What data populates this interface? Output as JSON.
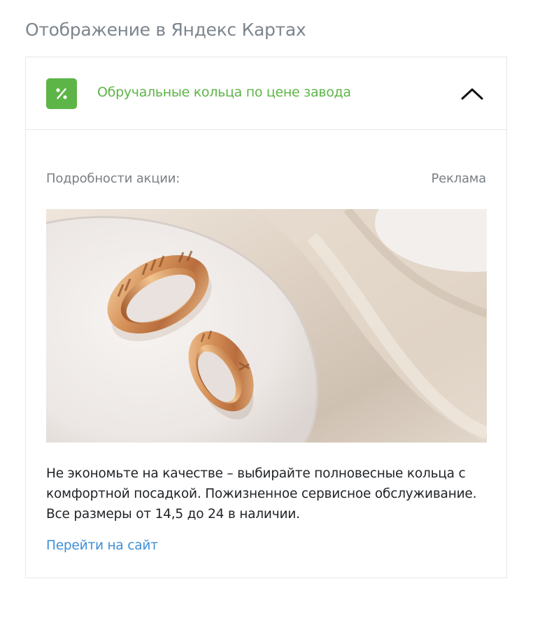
{
  "page": {
    "section_title": "Отображение в Яндекс Картах"
  },
  "promo": {
    "badge_icon": "percent-icon",
    "badge_color": "#5db548",
    "title": "Обручальные кольца по цене завода",
    "title_color": "#5db548",
    "collapse_icon": "chevron-up-icon",
    "details_label": "Подробности акции:",
    "ad_label": "Реклама",
    "image": "wedding-rings-photo",
    "description": "Не экономьте на качестве – выбирайте полновесные кольца с комфортной посадкой. Пожизненное сервисное обслуживание. Все размеры от 14,5 до 24 в наличии.",
    "link_label": "Перейти на сайт",
    "link_color": "#3d8fd6"
  }
}
